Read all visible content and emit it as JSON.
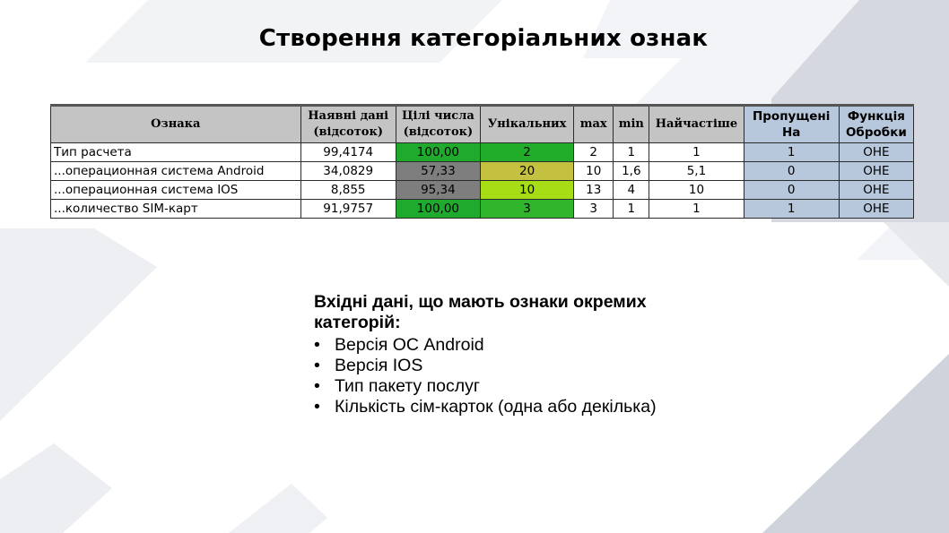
{
  "title": "Створення категоріальних ознак",
  "table": {
    "headers": [
      "Ознака",
      "Наявні дані (відсоток)",
      "Цілі числа (відсоток)",
      "Унікальних",
      "max",
      "min",
      "Найчастіше",
      "Пропущені На",
      "Функція Обробки"
    ],
    "header_lines": [
      [
        "Ознака"
      ],
      [
        "Наявні дані",
        "(відсоток)"
      ],
      [
        "Цілі числа",
        "(відсоток)"
      ],
      [
        "Унікальних"
      ],
      [
        "max"
      ],
      [
        "min"
      ],
      [
        "Найчастіше"
      ],
      [
        "Пропущені",
        "На"
      ],
      [
        "Функція",
        "Обробки"
      ]
    ],
    "rows": [
      {
        "name": "Тип расчета",
        "available": "99,4174",
        "integers": "100,00",
        "unique": "2",
        "max": "2",
        "min": "1",
        "most_frequent": "1",
        "missing": "1",
        "function": "OHE",
        "unique_color": "#21ad2a"
      },
      {
        "name": "...операционная система Android",
        "available": "34,0829",
        "integers": "57,33",
        "unique": "20",
        "max": "10",
        "min": "1,6",
        "most_frequent": "5,1",
        "missing": "0",
        "function": "OHE",
        "unique_color": "#c4c140"
      },
      {
        "name": "...операционная система IOS",
        "available": "8,855",
        "integers": "95,34",
        "unique": "10",
        "max": "13",
        "min": "4",
        "most_frequent": "10",
        "missing": "0",
        "function": "OHE",
        "unique_color": "#a7dd14"
      },
      {
        "name": "...количество SIM-карт",
        "available": "91,9757",
        "integers": "100,00",
        "unique": "3",
        "max": "3",
        "min": "1",
        "most_frequent": "1",
        "missing": "1",
        "function": "OHE",
        "unique_color": "#31b52c"
      }
    ],
    "colors": {
      "header_gray": "#c4c4c4",
      "header_blue": "#b8c8dc",
      "cell_gray": "#7e7e7e",
      "cell_green": "#1faa2d",
      "cell_blue": "#b8c8dc"
    }
  },
  "description": {
    "heading_lines": [
      "Вхідні дані, що мають ознаки окремих",
      "категорій:"
    ],
    "bullet_glyph": "•",
    "bullets": [
      "Версія ОС Android",
      "Версія IOS",
      "Тип пакету послуг",
      "Кількість сім-карток (одна або декілька)"
    ]
  }
}
